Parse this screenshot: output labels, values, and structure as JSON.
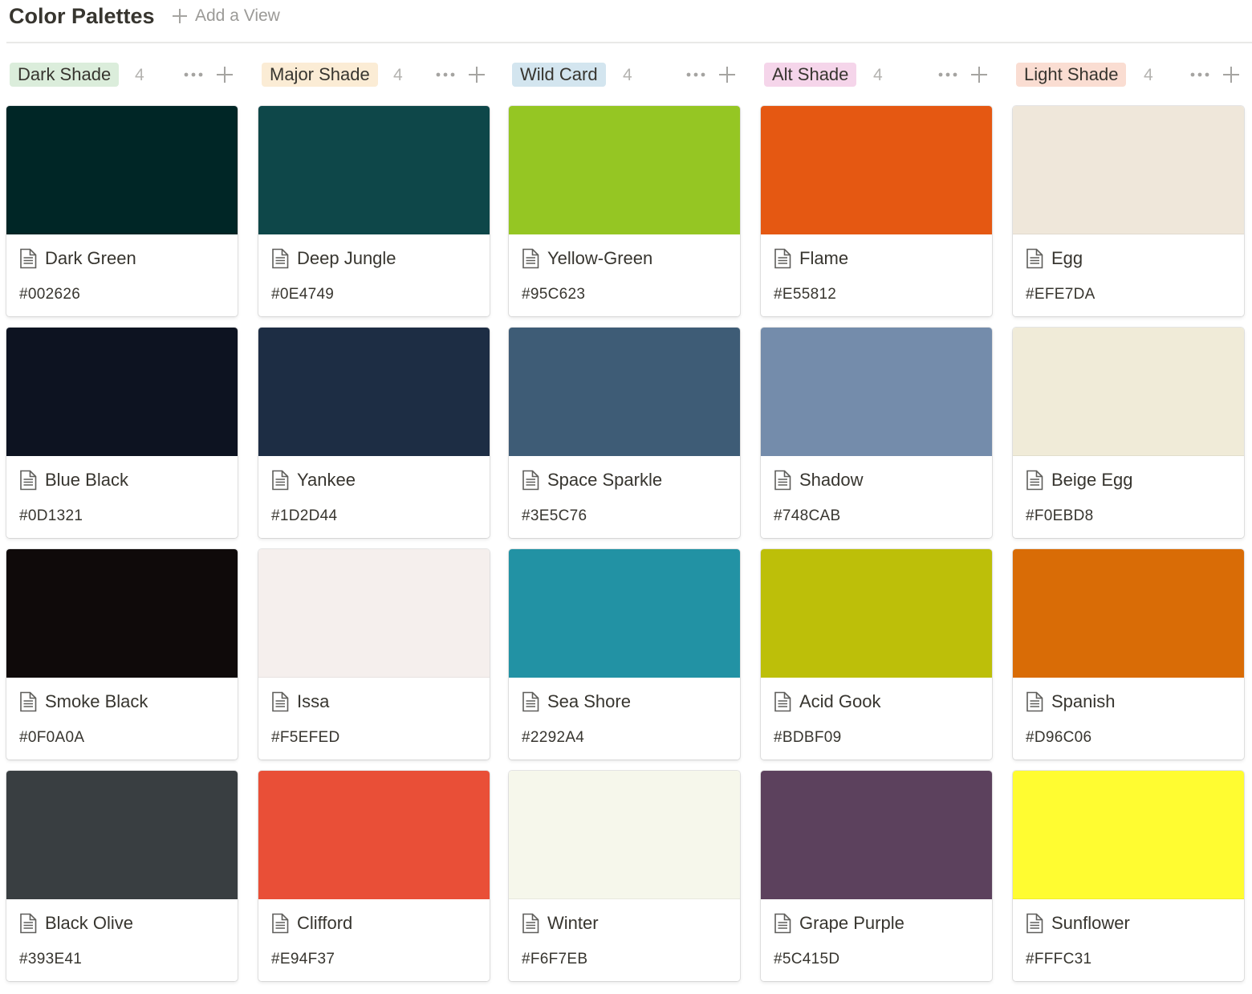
{
  "page": {
    "title": "Color Palettes",
    "add_view_label": "Add a View"
  },
  "columns": [
    {
      "name": "Dark Shade",
      "count": "4",
      "tag_color": "#DBEDDB",
      "cards": [
        {
          "name": "Dark Green",
          "hex": "#002626",
          "color": "#002626"
        },
        {
          "name": "Blue Black",
          "hex": "#0D1321",
          "color": "#0D1321"
        },
        {
          "name": "Smoke Black",
          "hex": "#0F0A0A",
          "color": "#0F0A0A"
        },
        {
          "name": "Black Olive",
          "hex": "#393E41",
          "color": "#393E41"
        }
      ]
    },
    {
      "name": "Major Shade",
      "count": "4",
      "tag_color": "#FBECD5",
      "cards": [
        {
          "name": "Deep Jungle",
          "hex": "#0E4749",
          "color": "#0E4749"
        },
        {
          "name": "Yankee",
          "hex": "#1D2D44",
          "color": "#1D2D44"
        },
        {
          "name": "Issa",
          "hex": "#F5EFED",
          "color": "#F5EFED"
        },
        {
          "name": "Clifford",
          "hex": "#E94F37",
          "color": "#E94F37"
        }
      ]
    },
    {
      "name": "Wild Card",
      "count": "4",
      "tag_color": "#D3E5EF",
      "cards": [
        {
          "name": "Yellow-Green",
          "hex": "#95C623",
          "color": "#95C623"
        },
        {
          "name": "Space Sparkle",
          "hex": "#3E5C76",
          "color": "#3E5C76"
        },
        {
          "name": "Sea Shore",
          "hex": "#2292A4",
          "color": "#2292A4"
        },
        {
          "name": "Winter",
          "hex": "#F6F7EB",
          "color": "#F6F7EB"
        }
      ]
    },
    {
      "name": "Alt Shade",
      "count": "4",
      "tag_color": "#F5D5EA",
      "cards": [
        {
          "name": "Flame",
          "hex": "#E55812",
          "color": "#E55812"
        },
        {
          "name": "Shadow",
          "hex": "#748CAB",
          "color": "#748CAB"
        },
        {
          "name": "Acid Gook",
          "hex": "#BDBF09",
          "color": "#BDBF09"
        },
        {
          "name": "Grape Purple",
          "hex": "#5C415D",
          "color": "#5C415D"
        }
      ]
    },
    {
      "name": "Light Shade",
      "count": "4",
      "tag_color": "#FADDD2",
      "cards": [
        {
          "name": "Egg",
          "hex": "#EFE7DA",
          "color": "#EFE7DA"
        },
        {
          "name": "Beige Egg",
          "hex": "#F0EBD8",
          "color": "#F0EBD8"
        },
        {
          "name": "Spanish",
          "hex": "#D96C06",
          "color": "#D96C06"
        },
        {
          "name": "Sunflower",
          "hex": "#FFFC31",
          "color": "#FFFC31"
        }
      ]
    }
  ]
}
